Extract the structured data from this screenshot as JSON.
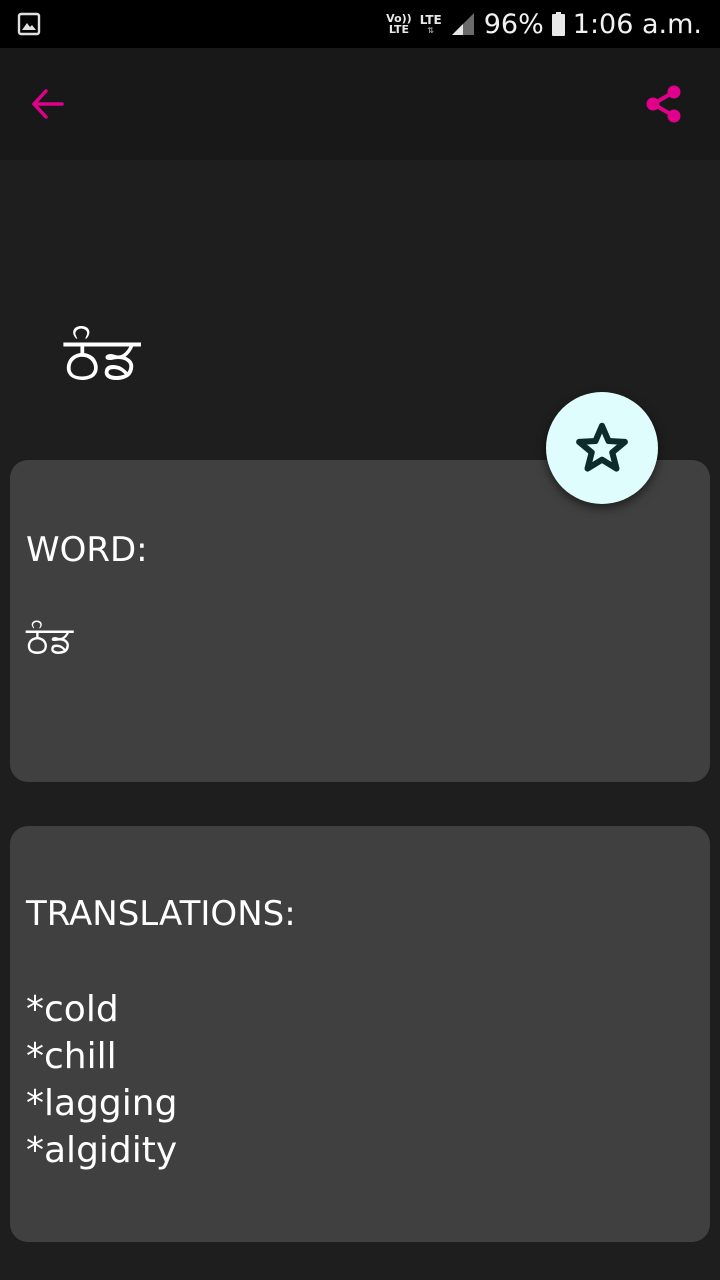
{
  "status_bar": {
    "volte": "Vo)) LTE",
    "network": "LTE",
    "battery_percent": "96%",
    "time": "1:06 a.m."
  },
  "toolbar": {
    "back_icon": "arrow-back-icon",
    "share_icon": "share-icon",
    "accent_color": "#e0008a"
  },
  "header": {
    "word": "ਠੰਡ"
  },
  "word_card": {
    "label": "WORD:",
    "value": "ਠੰਡ"
  },
  "translations_card": {
    "label": "TRANSLATIONS:",
    "items": [
      "*cold",
      "*chill",
      "*lagging",
      "*algidity"
    ]
  },
  "fab": {
    "icon": "star-icon",
    "background": "#dffdfd"
  }
}
